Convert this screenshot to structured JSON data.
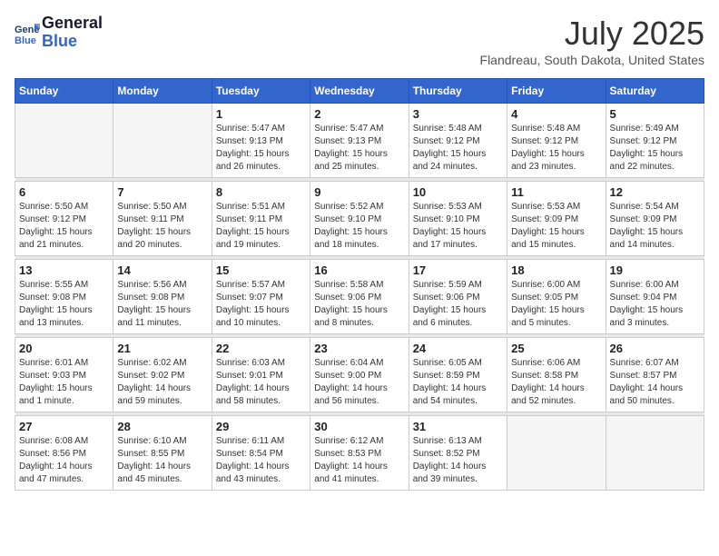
{
  "header": {
    "logo_line1": "General",
    "logo_line2": "Blue",
    "month_year": "July 2025",
    "location": "Flandreau, South Dakota, United States"
  },
  "weekdays": [
    "Sunday",
    "Monday",
    "Tuesday",
    "Wednesday",
    "Thursday",
    "Friday",
    "Saturday"
  ],
  "weeks": [
    [
      {
        "day": "",
        "info": ""
      },
      {
        "day": "",
        "info": ""
      },
      {
        "day": "1",
        "info": "Sunrise: 5:47 AM\nSunset: 9:13 PM\nDaylight: 15 hours\nand 26 minutes."
      },
      {
        "day": "2",
        "info": "Sunrise: 5:47 AM\nSunset: 9:13 PM\nDaylight: 15 hours\nand 25 minutes."
      },
      {
        "day": "3",
        "info": "Sunrise: 5:48 AM\nSunset: 9:12 PM\nDaylight: 15 hours\nand 24 minutes."
      },
      {
        "day": "4",
        "info": "Sunrise: 5:48 AM\nSunset: 9:12 PM\nDaylight: 15 hours\nand 23 minutes."
      },
      {
        "day": "5",
        "info": "Sunrise: 5:49 AM\nSunset: 9:12 PM\nDaylight: 15 hours\nand 22 minutes."
      }
    ],
    [
      {
        "day": "6",
        "info": "Sunrise: 5:50 AM\nSunset: 9:12 PM\nDaylight: 15 hours\nand 21 minutes."
      },
      {
        "day": "7",
        "info": "Sunrise: 5:50 AM\nSunset: 9:11 PM\nDaylight: 15 hours\nand 20 minutes."
      },
      {
        "day": "8",
        "info": "Sunrise: 5:51 AM\nSunset: 9:11 PM\nDaylight: 15 hours\nand 19 minutes."
      },
      {
        "day": "9",
        "info": "Sunrise: 5:52 AM\nSunset: 9:10 PM\nDaylight: 15 hours\nand 18 minutes."
      },
      {
        "day": "10",
        "info": "Sunrise: 5:53 AM\nSunset: 9:10 PM\nDaylight: 15 hours\nand 17 minutes."
      },
      {
        "day": "11",
        "info": "Sunrise: 5:53 AM\nSunset: 9:09 PM\nDaylight: 15 hours\nand 15 minutes."
      },
      {
        "day": "12",
        "info": "Sunrise: 5:54 AM\nSunset: 9:09 PM\nDaylight: 15 hours\nand 14 minutes."
      }
    ],
    [
      {
        "day": "13",
        "info": "Sunrise: 5:55 AM\nSunset: 9:08 PM\nDaylight: 15 hours\nand 13 minutes."
      },
      {
        "day": "14",
        "info": "Sunrise: 5:56 AM\nSunset: 9:08 PM\nDaylight: 15 hours\nand 11 minutes."
      },
      {
        "day": "15",
        "info": "Sunrise: 5:57 AM\nSunset: 9:07 PM\nDaylight: 15 hours\nand 10 minutes."
      },
      {
        "day": "16",
        "info": "Sunrise: 5:58 AM\nSunset: 9:06 PM\nDaylight: 15 hours\nand 8 minutes."
      },
      {
        "day": "17",
        "info": "Sunrise: 5:59 AM\nSunset: 9:06 PM\nDaylight: 15 hours\nand 6 minutes."
      },
      {
        "day": "18",
        "info": "Sunrise: 6:00 AM\nSunset: 9:05 PM\nDaylight: 15 hours\nand 5 minutes."
      },
      {
        "day": "19",
        "info": "Sunrise: 6:00 AM\nSunset: 9:04 PM\nDaylight: 15 hours\nand 3 minutes."
      }
    ],
    [
      {
        "day": "20",
        "info": "Sunrise: 6:01 AM\nSunset: 9:03 PM\nDaylight: 15 hours\nand 1 minute."
      },
      {
        "day": "21",
        "info": "Sunrise: 6:02 AM\nSunset: 9:02 PM\nDaylight: 14 hours\nand 59 minutes."
      },
      {
        "day": "22",
        "info": "Sunrise: 6:03 AM\nSunset: 9:01 PM\nDaylight: 14 hours\nand 58 minutes."
      },
      {
        "day": "23",
        "info": "Sunrise: 6:04 AM\nSunset: 9:00 PM\nDaylight: 14 hours\nand 56 minutes."
      },
      {
        "day": "24",
        "info": "Sunrise: 6:05 AM\nSunset: 8:59 PM\nDaylight: 14 hours\nand 54 minutes."
      },
      {
        "day": "25",
        "info": "Sunrise: 6:06 AM\nSunset: 8:58 PM\nDaylight: 14 hours\nand 52 minutes."
      },
      {
        "day": "26",
        "info": "Sunrise: 6:07 AM\nSunset: 8:57 PM\nDaylight: 14 hours\nand 50 minutes."
      }
    ],
    [
      {
        "day": "27",
        "info": "Sunrise: 6:08 AM\nSunset: 8:56 PM\nDaylight: 14 hours\nand 47 minutes."
      },
      {
        "day": "28",
        "info": "Sunrise: 6:10 AM\nSunset: 8:55 PM\nDaylight: 14 hours\nand 45 minutes."
      },
      {
        "day": "29",
        "info": "Sunrise: 6:11 AM\nSunset: 8:54 PM\nDaylight: 14 hours\nand 43 minutes."
      },
      {
        "day": "30",
        "info": "Sunrise: 6:12 AM\nSunset: 8:53 PM\nDaylight: 14 hours\nand 41 minutes."
      },
      {
        "day": "31",
        "info": "Sunrise: 6:13 AM\nSunset: 8:52 PM\nDaylight: 14 hours\nand 39 minutes."
      },
      {
        "day": "",
        "info": ""
      },
      {
        "day": "",
        "info": ""
      }
    ]
  ]
}
